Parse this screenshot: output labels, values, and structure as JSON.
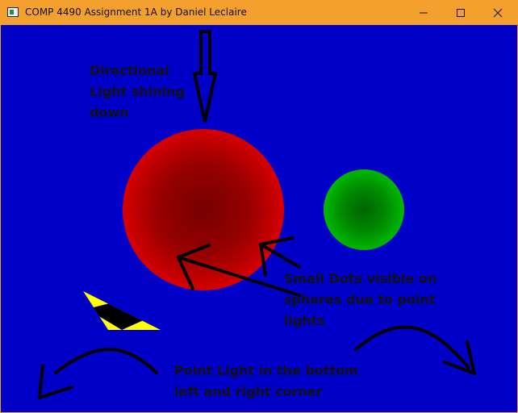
{
  "window": {
    "title": "COMP 4490 Assignment 1A by Daniel Leclaire",
    "icon": "app-window-icon",
    "controls": [
      "minimize-icon",
      "maximize-icon",
      "close-icon"
    ]
  },
  "scene": {
    "background_color": "#0000c8",
    "labels": {
      "directional_line1": "Directional",
      "directional_line2": "Light shining",
      "directional_line3": "down",
      "dots_line1": "Small Dots visible on",
      "dots_line2": "spheres due to point",
      "dots_line3": "lights",
      "point_line1": "Point Light in the bottom",
      "point_line2": "left and right corner"
    },
    "colors": {
      "red_sphere": "#d40000",
      "green_sphere": "#00b400",
      "stripe_yellow": "#ffff00",
      "annotation_ink": "#000000"
    }
  }
}
